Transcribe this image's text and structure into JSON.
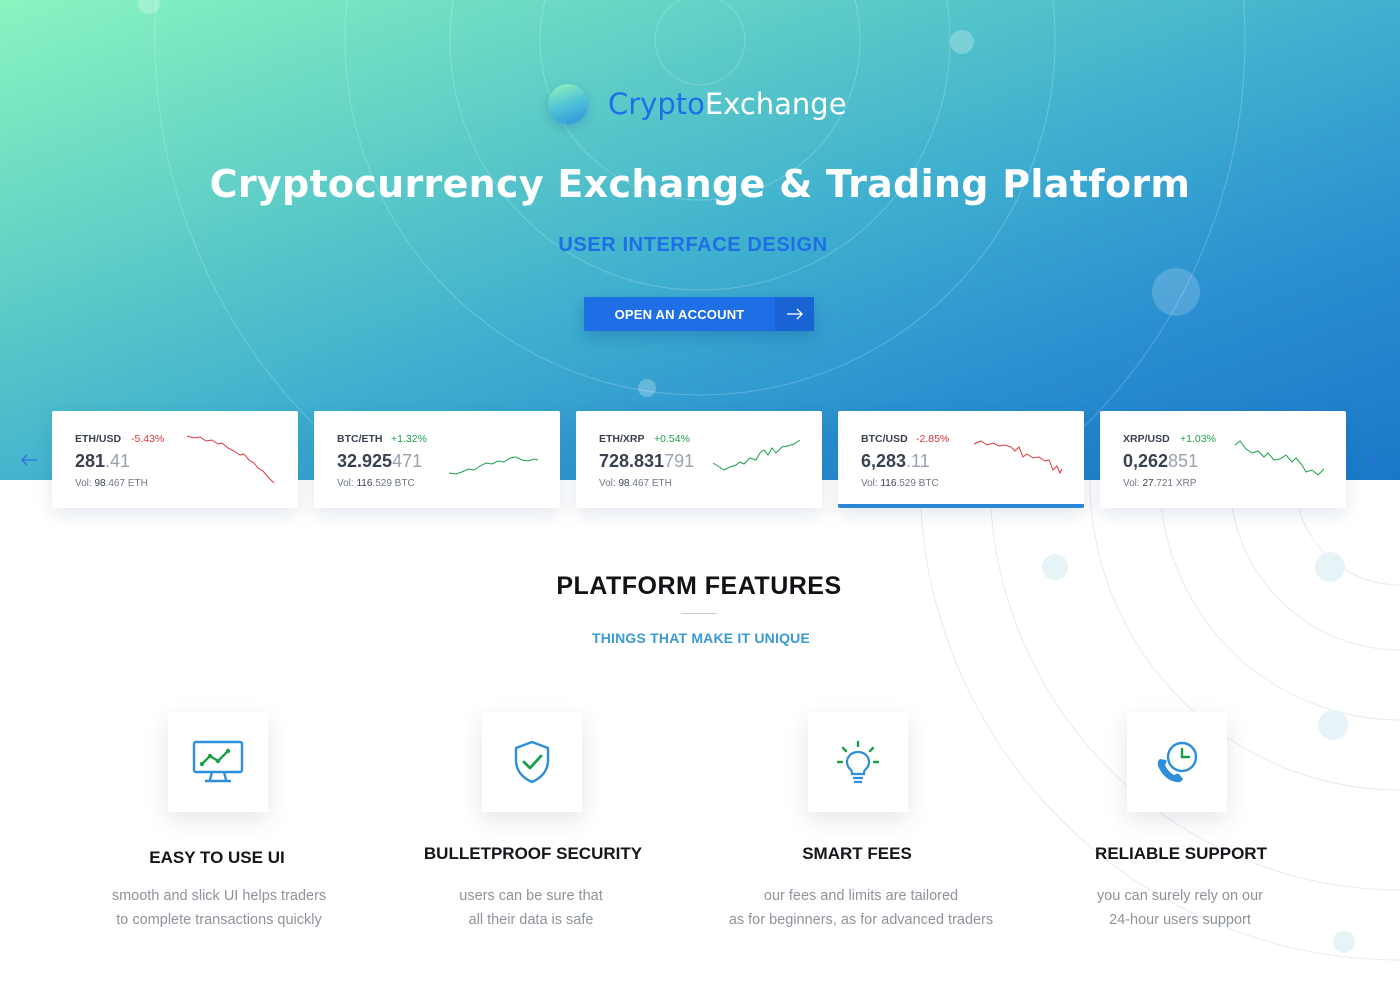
{
  "brand": {
    "part1": "Crypto",
    "part2": "Exchange"
  },
  "hero": {
    "title": "Cryptocurrency Exchange & Trading Platform",
    "subtitle": "USER INTERFACE DESIGN",
    "cta_label": "OPEN AN ACCOUNT"
  },
  "colors": {
    "brand_blue": "#1e6fe6",
    "positive": "#1aa04a",
    "negative": "#e0343c",
    "accent": "#3a9ad6"
  },
  "tickers": [
    {
      "pair": "ETH/USD",
      "change": "-5.43%",
      "price_main": "281",
      "price_dim": ".41",
      "vol_label": "Vol:",
      "vol_main": "98",
      "vol_rest": ".467 ETH",
      "trend": "down"
    },
    {
      "pair": "BTC/ETH",
      "change": "+1.32%",
      "price_main": "32.925",
      "price_dim": "471",
      "vol_label": "Vol:",
      "vol_main": "116",
      "vol_rest": ".529 BTC",
      "trend": "up"
    },
    {
      "pair": "ETH/XRP",
      "change": "+0.54%",
      "price_main": "728.831",
      "price_dim": "791",
      "vol_label": "Vol:",
      "vol_main": "98",
      "vol_rest": ".467 ETH",
      "trend": "up"
    },
    {
      "pair": "BTC/USD",
      "change": "-2.85%",
      "price_main": "6,283",
      "price_dim": ".11",
      "vol_label": "Vol:",
      "vol_main": "116",
      "vol_rest": ".529 BTC",
      "trend": "down",
      "active": true
    },
    {
      "pair": "XRP/USD",
      "change": "+1.03%",
      "price_main": "0,262",
      "price_dim": "851",
      "vol_label": "Vol:",
      "vol_main": "27",
      "vol_rest": ".721 XRP",
      "trend": "up"
    }
  ],
  "features": {
    "title": "PLATFORM FEATURES",
    "subtitle": "THINGS THAT MAKE IT UNIQUE",
    "items": [
      {
        "icon": "monitor-chart-icon",
        "title": "EASY TO USE UI",
        "desc": "smooth and slick UI helps traders\n to complete  transactions quickly"
      },
      {
        "icon": "shield-check-icon",
        "title": "BULLETPROOF SECURITY",
        "desc": "users can be sure that\nall their data is safe"
      },
      {
        "icon": "lightbulb-icon",
        "title": "SMART FEES",
        "desc": "our fees and limits are tailored\nas for beginners, as for advanced traders"
      },
      {
        "icon": "phone-clock-icon",
        "title": "RELIABLE SUPPORT",
        "desc": "you can surely rely on our\n24-hour users support"
      }
    ]
  }
}
